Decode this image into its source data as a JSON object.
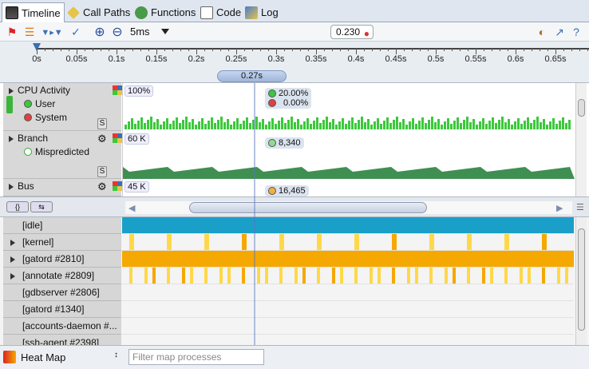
{
  "tabs": [
    {
      "label": "Timeline",
      "icon": "timeline-icon",
      "active": true
    },
    {
      "label": "Call Paths",
      "icon": "call-paths-icon"
    },
    {
      "label": "Functions",
      "icon": "functions-icon"
    },
    {
      "label": "Code",
      "icon": "code-icon"
    },
    {
      "label": "Log",
      "icon": "log-icon"
    }
  ],
  "toolbar": {
    "zoom": "5ms",
    "time_value": "0.230"
  },
  "ruler": {
    "ticks": [
      "0s",
      "0.05s",
      "0.1s",
      "0.15s",
      "0.2s",
      "0.25s",
      "0.3s",
      "0.35s",
      "0.4s",
      "0.45s",
      "0.5s",
      "0.55s",
      "0.6s",
      "0.65s"
    ],
    "selection": "0.27s"
  },
  "charts": [
    {
      "title": "CPU Activity",
      "max": "100%",
      "legend": [
        {
          "label": "User",
          "color": "#3cc83c"
        },
        {
          "label": "System",
          "color": "#e04040"
        }
      ],
      "values": [
        "20.00%",
        "0.00%"
      ]
    },
    {
      "title": "Branch",
      "max": "60 K",
      "legend": [
        {
          "label": "Mispredicted",
          "color": "#3cc83c"
        }
      ],
      "values": [
        "8,340"
      ]
    },
    {
      "title": "Bus",
      "max": "45 K",
      "legend": [],
      "values": [
        "16,465"
      ]
    }
  ],
  "heatmap": {
    "rows": [
      {
        "name": "[idle]",
        "expandable": false
      },
      {
        "name": "[kernel]",
        "expandable": true
      },
      {
        "name": "[gatord #2810]",
        "expandable": true
      },
      {
        "name": "[annotate #2809]",
        "expandable": true
      },
      {
        "name": "[gdbserver #2806]",
        "expandable": false
      },
      {
        "name": "[gatord #1340]",
        "expandable": false
      },
      {
        "name": "[accounts-daemon #...",
        "expandable": false
      },
      {
        "name": "[ssh-agent #2398]",
        "expandable": false
      }
    ]
  },
  "bottom": {
    "mode": "Heat Map",
    "filter_placeholder": "Filter map processes"
  },
  "colors": {
    "idle": "#1a9fc9",
    "hot": "#f5a800",
    "warm": "#ffd84a",
    "cpu_bar": "#3cc83c"
  }
}
